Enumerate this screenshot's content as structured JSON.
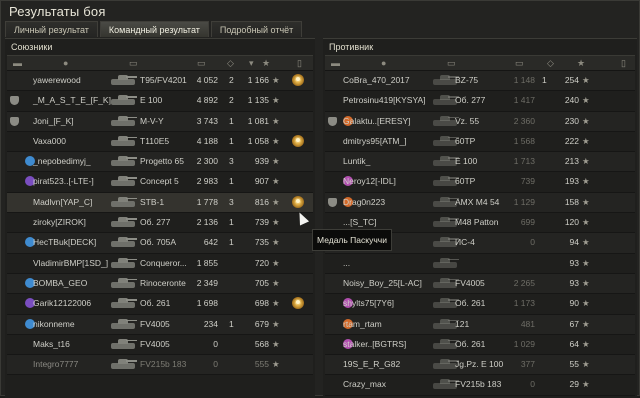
{
  "window": {
    "title": "Результаты боя"
  },
  "tabs": [
    {
      "label": "Личный результат",
      "active": false
    },
    {
      "label": "Командный результат",
      "active": true
    },
    {
      "label": "Подробный отчёт",
      "active": false
    }
  ],
  "allies": {
    "title": "Союзники",
    "rows": [
      {
        "name": "yawerewood",
        "tank": "T95/FV4201",
        "damage": "4 052",
        "frags": "2",
        "xp": "1 166",
        "medal": true,
        "clan": false,
        "platoon": false,
        "alive": true
      },
      {
        "name": "_M_A_S_T_E_[F_K]",
        "tank": "E 100",
        "damage": "4 892",
        "frags": "2",
        "xp": "1 135",
        "medal": false,
        "clan": true,
        "platoon": false,
        "alive": true
      },
      {
        "name": "Joni_[F_K]",
        "tank": "M-V-Y",
        "damage": "3 743",
        "frags": "1",
        "xp": "1 081",
        "medal": false,
        "clan": true,
        "platoon": false,
        "alive": true
      },
      {
        "name": "Vaxa000",
        "tank": "T110E5",
        "damage": "4 188",
        "frags": "1",
        "xp": "1 058",
        "medal": true,
        "clan": false,
        "platoon": false,
        "alive": true
      },
      {
        "name": "_nepobedimyj_",
        "tank": "Progetto 65",
        "damage": "2 300",
        "frags": "3",
        "xp": "939",
        "medal": false,
        "clan": false,
        "platoon": true,
        "alive": true
      },
      {
        "name": "pirat523..[-LTE-]",
        "tank": "Concept 5",
        "damage": "2 983",
        "frags": "1",
        "xp": "907",
        "medal": false,
        "clan": false,
        "platoon": true,
        "alive": true
      },
      {
        "name": "Madlvn[YAP_C]",
        "tank": "STB-1",
        "damage": "1 778",
        "frags": "3",
        "xp": "816",
        "medal": true,
        "clan": false,
        "platoon": false,
        "alive": true,
        "me": true
      },
      {
        "name": "ziroky[ZIROK]",
        "tank": "Об. 277",
        "damage": "2 136",
        "frags": "1",
        "xp": "739",
        "medal": false,
        "clan": false,
        "platoon": false,
        "alive": true
      },
      {
        "name": "HecTBuk[DECK]",
        "tank": "Об. 705А",
        "damage": "642",
        "frags": "1",
        "xp": "735",
        "medal": false,
        "clan": false,
        "platoon": true,
        "alive": true
      },
      {
        "name": "VladimirBMP[1SD_]",
        "tank": "Conqueror...",
        "damage": "1 855",
        "frags": "",
        "xp": "720",
        "medal": false,
        "clan": false,
        "platoon": false,
        "alive": true
      },
      {
        "name": "BOMBA_GEO",
        "tank": "Rinoceronte",
        "damage": "2 349",
        "frags": "",
        "xp": "705",
        "medal": false,
        "clan": false,
        "platoon": true,
        "alive": true
      },
      {
        "name": "Garik12122006",
        "tank": "Об. 261",
        "damage": "1 698",
        "frags": "",
        "xp": "698",
        "medal": true,
        "clan": false,
        "platoon": true,
        "alive": true
      },
      {
        "name": "nikonneme",
        "tank": "FV4005",
        "damage": "234",
        "frags": "1",
        "xp": "679",
        "medal": false,
        "clan": false,
        "platoon": true,
        "alive": true
      },
      {
        "name": "Maks_t16",
        "tank": "FV4005",
        "damage": "0",
        "frags": "",
        "xp": "568",
        "medal": false,
        "clan": false,
        "platoon": false,
        "alive": true
      },
      {
        "name": "Integro7777",
        "tank": "FV215b 183",
        "damage": "0",
        "frags": "",
        "xp": "555",
        "medal": false,
        "clan": false,
        "platoon": false,
        "alive": false
      }
    ]
  },
  "enemies": {
    "title": "Противник",
    "rows": [
      {
        "name": "CoBra_470_2017",
        "tank": "BZ-75",
        "damage": "1 148",
        "frags": "1",
        "xp": "254",
        "clan": false,
        "platoon": false
      },
      {
        "name": "Petrosinu419[KYSYA]",
        "tank": "Об. 277",
        "damage": "1 417",
        "frags": "",
        "xp": "240",
        "clan": false,
        "platoon": false
      },
      {
        "name": "Galaktu..[ERESY]",
        "tank": "Vz. 55",
        "damage": "2 360",
        "frags": "",
        "xp": "230",
        "clan": true,
        "platoon": true
      },
      {
        "name": "dmitrys95[ATM_]",
        "tank": "60TP",
        "damage": "1 568",
        "frags": "",
        "xp": "222",
        "clan": false,
        "platoon": false
      },
      {
        "name": "Luntik_",
        "tank": "E 100",
        "damage": "1 713",
        "frags": "",
        "xp": "213",
        "clan": false,
        "platoon": false
      },
      {
        "name": "Neroy12[-IDL]",
        "tank": "60TP",
        "damage": "739",
        "frags": "",
        "xp": "193",
        "clan": false,
        "platoon": true
      },
      {
        "name": "Drag0n223",
        "tank": "AMX M4 54",
        "damage": "1 129",
        "frags": "",
        "xp": "158",
        "clan": true,
        "platoon": true
      },
      {
        "name": "...[S_TC]",
        "tank": "M48 Patton",
        "damage": "699",
        "frags": "",
        "xp": "120",
        "clan": false,
        "platoon": false
      },
      {
        "name": "...",
        "tank": "ИС-4",
        "damage": "0",
        "frags": "",
        "xp": "94",
        "clan": false,
        "platoon": true
      },
      {
        "name": "...",
        "tank": "",
        "damage": "",
        "frags": "",
        "xp": "93",
        "clan": false,
        "platoon": false
      },
      {
        "name": "Noisy_Boy_25[L-AC]",
        "tank": "FV4005",
        "damage": "2 265",
        "frags": "",
        "xp": "93",
        "clan": false,
        "platoon": false
      },
      {
        "name": "shylts75[7Y6]",
        "tank": "Об. 261",
        "damage": "1 173",
        "frags": "",
        "xp": "90",
        "clan": false,
        "platoon": true
      },
      {
        "name": "rtam_rtam",
        "tank": "121",
        "damage": "481",
        "frags": "",
        "xp": "67",
        "clan": false,
        "platoon": true
      },
      {
        "name": "stalker..[BGTRS]",
        "tank": "Об. 261",
        "damage": "1 029",
        "frags": "",
        "xp": "64",
        "clan": false,
        "platoon": true
      },
      {
        "name": "19S_E_R_G82",
        "tank": "Jg.Pz. E 100",
        "damage": "377",
        "frags": "",
        "xp": "55",
        "clan": false,
        "platoon": false
      },
      {
        "name": "Crazy_max",
        "tank": "FV215b 183",
        "damage": "0",
        "frags": "",
        "xp": "29",
        "clan": false,
        "platoon": false
      }
    ]
  },
  "tooltip": {
    "text": "Медаль Паскуччи"
  },
  "colors": {
    "background": "#232321",
    "gold": "#e4b34a",
    "dead": "#7d7c74"
  }
}
